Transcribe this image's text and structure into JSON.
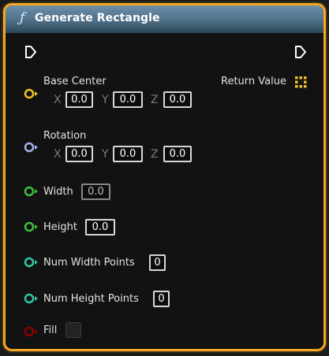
{
  "node": {
    "title": "Generate Rectangle",
    "function_icon": "ƒ",
    "colors": {
      "border": "#f5a623",
      "vector_pin": "#f0c22a",
      "rotator_pin": "#a3b2e8",
      "float_pin": "#3fbf3f",
      "int_pin": "#2ec7a4",
      "bool_pin": "#8a0000"
    }
  },
  "pins": {
    "base_center": {
      "label": "Base Center",
      "x_label": "X",
      "x": "0.0",
      "y_label": "Y",
      "y": "0.0",
      "z_label": "Z",
      "z": "0.0"
    },
    "rotation": {
      "label": "Rotation",
      "x_label": "X",
      "x": "0.0",
      "y_label": "Y",
      "y": "0.0",
      "z_label": "Z",
      "z": "0.0"
    },
    "width": {
      "label": "Width",
      "value": "0.0"
    },
    "height": {
      "label": "Height",
      "value": "0.0"
    },
    "num_width_points": {
      "label": "Num Width Points",
      "value": "0"
    },
    "num_height_points": {
      "label": "Num Height Points",
      "value": "0"
    },
    "fill": {
      "label": "Fill",
      "checked": false
    }
  },
  "outputs": {
    "return_value": {
      "label": "Return Value",
      "icon": "grid-icon"
    }
  }
}
